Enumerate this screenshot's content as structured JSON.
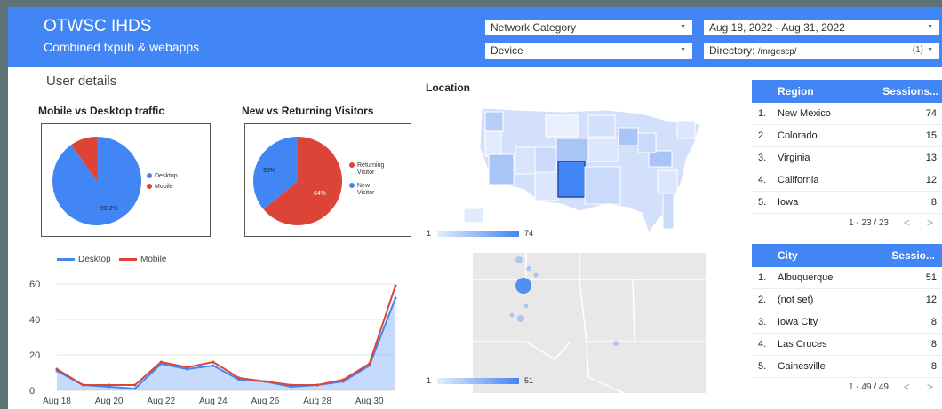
{
  "header": {
    "title": "OTWSC IHDS",
    "subtitle": "Combined txpub & webapps"
  },
  "controls": {
    "network_category": "Network Category",
    "device": "Device",
    "date_range": "Aug 18, 2022 - Aug 31, 2022",
    "directory_label": "Directory:",
    "directory_value": "/mrgescp/",
    "directory_count": "(1)"
  },
  "section": {
    "user_details": "User details",
    "location": "Location"
  },
  "pie_device": {
    "title": "Mobile vs Desktop traffic",
    "slices": [
      {
        "label": "Desktop",
        "value": 90.2,
        "color": "#4285f4",
        "display": "90.2%"
      },
      {
        "label": "Mobile",
        "value": 9.8,
        "color": "#db4437",
        "display": ""
      }
    ]
  },
  "pie_visitor": {
    "title": "New vs Returning Visitors",
    "slices": [
      {
        "label": "Returning Visitor",
        "value": 64,
        "color": "#db4437",
        "display": "64%"
      },
      {
        "label": "New Visitor",
        "value": 36,
        "color": "#4285f4",
        "display": "36%"
      }
    ],
    "legend": [
      "Returning",
      "Visitor",
      "New",
      "Visitor"
    ]
  },
  "chart_data": {
    "type": "area",
    "x": [
      "Aug 18",
      "Aug 19",
      "Aug 20",
      "Aug 21",
      "Aug 22",
      "Aug 23",
      "Aug 24",
      "Aug 25",
      "Aug 26",
      "Aug 27",
      "Aug 28",
      "Aug 29",
      "Aug 30",
      "Aug 31"
    ],
    "xticks": [
      "Aug 18",
      "Aug 20",
      "Aug 22",
      "Aug 24",
      "Aug 26",
      "Aug 28",
      "Aug 30"
    ],
    "series": [
      {
        "name": "Desktop",
        "color": "#4285f4",
        "values": [
          11,
          3,
          2,
          1,
          15,
          12,
          14,
          6,
          5,
          2,
          3,
          5,
          14,
          52
        ]
      },
      {
        "name": "Mobile",
        "color": "#db4437",
        "values": [
          12,
          3,
          3,
          3,
          16,
          13,
          16,
          7,
          5,
          3,
          3,
          6,
          15,
          59
        ]
      }
    ],
    "yticks": [
      0,
      20,
      40,
      60
    ],
    "ylim": [
      0,
      60
    ]
  },
  "map": {
    "us_min": "1",
    "us_max": "74",
    "nm_min": "1",
    "nm_max": "51"
  },
  "region_table": {
    "header": [
      "Region",
      "Sessions..."
    ],
    "rows": [
      {
        "idx": "1.",
        "name": "New Mexico",
        "value": "74"
      },
      {
        "idx": "2.",
        "name": "Colorado",
        "value": "15"
      },
      {
        "idx": "3.",
        "name": "Virginia",
        "value": "13"
      },
      {
        "idx": "4.",
        "name": "California",
        "value": "12"
      },
      {
        "idx": "5.",
        "name": "Iowa",
        "value": "8"
      }
    ],
    "pagination": "1 - 23 / 23"
  },
  "city_table": {
    "header": [
      "City",
      "Sessio..."
    ],
    "rows": [
      {
        "idx": "1.",
        "name": "Albuquerque",
        "value": "51"
      },
      {
        "idx": "2.",
        "name": "(not set)",
        "value": "12"
      },
      {
        "idx": "3.",
        "name": "Iowa City",
        "value": "8"
      },
      {
        "idx": "4.",
        "name": "Las Cruces",
        "value": "8"
      },
      {
        "idx": "5.",
        "name": "Gainesville",
        "value": "8"
      }
    ],
    "pagination": "1 - 49 / 49"
  },
  "colors": {
    "accent": "#4285f4",
    "mobile": "#db4437",
    "frame_bg": "#5d7273"
  }
}
